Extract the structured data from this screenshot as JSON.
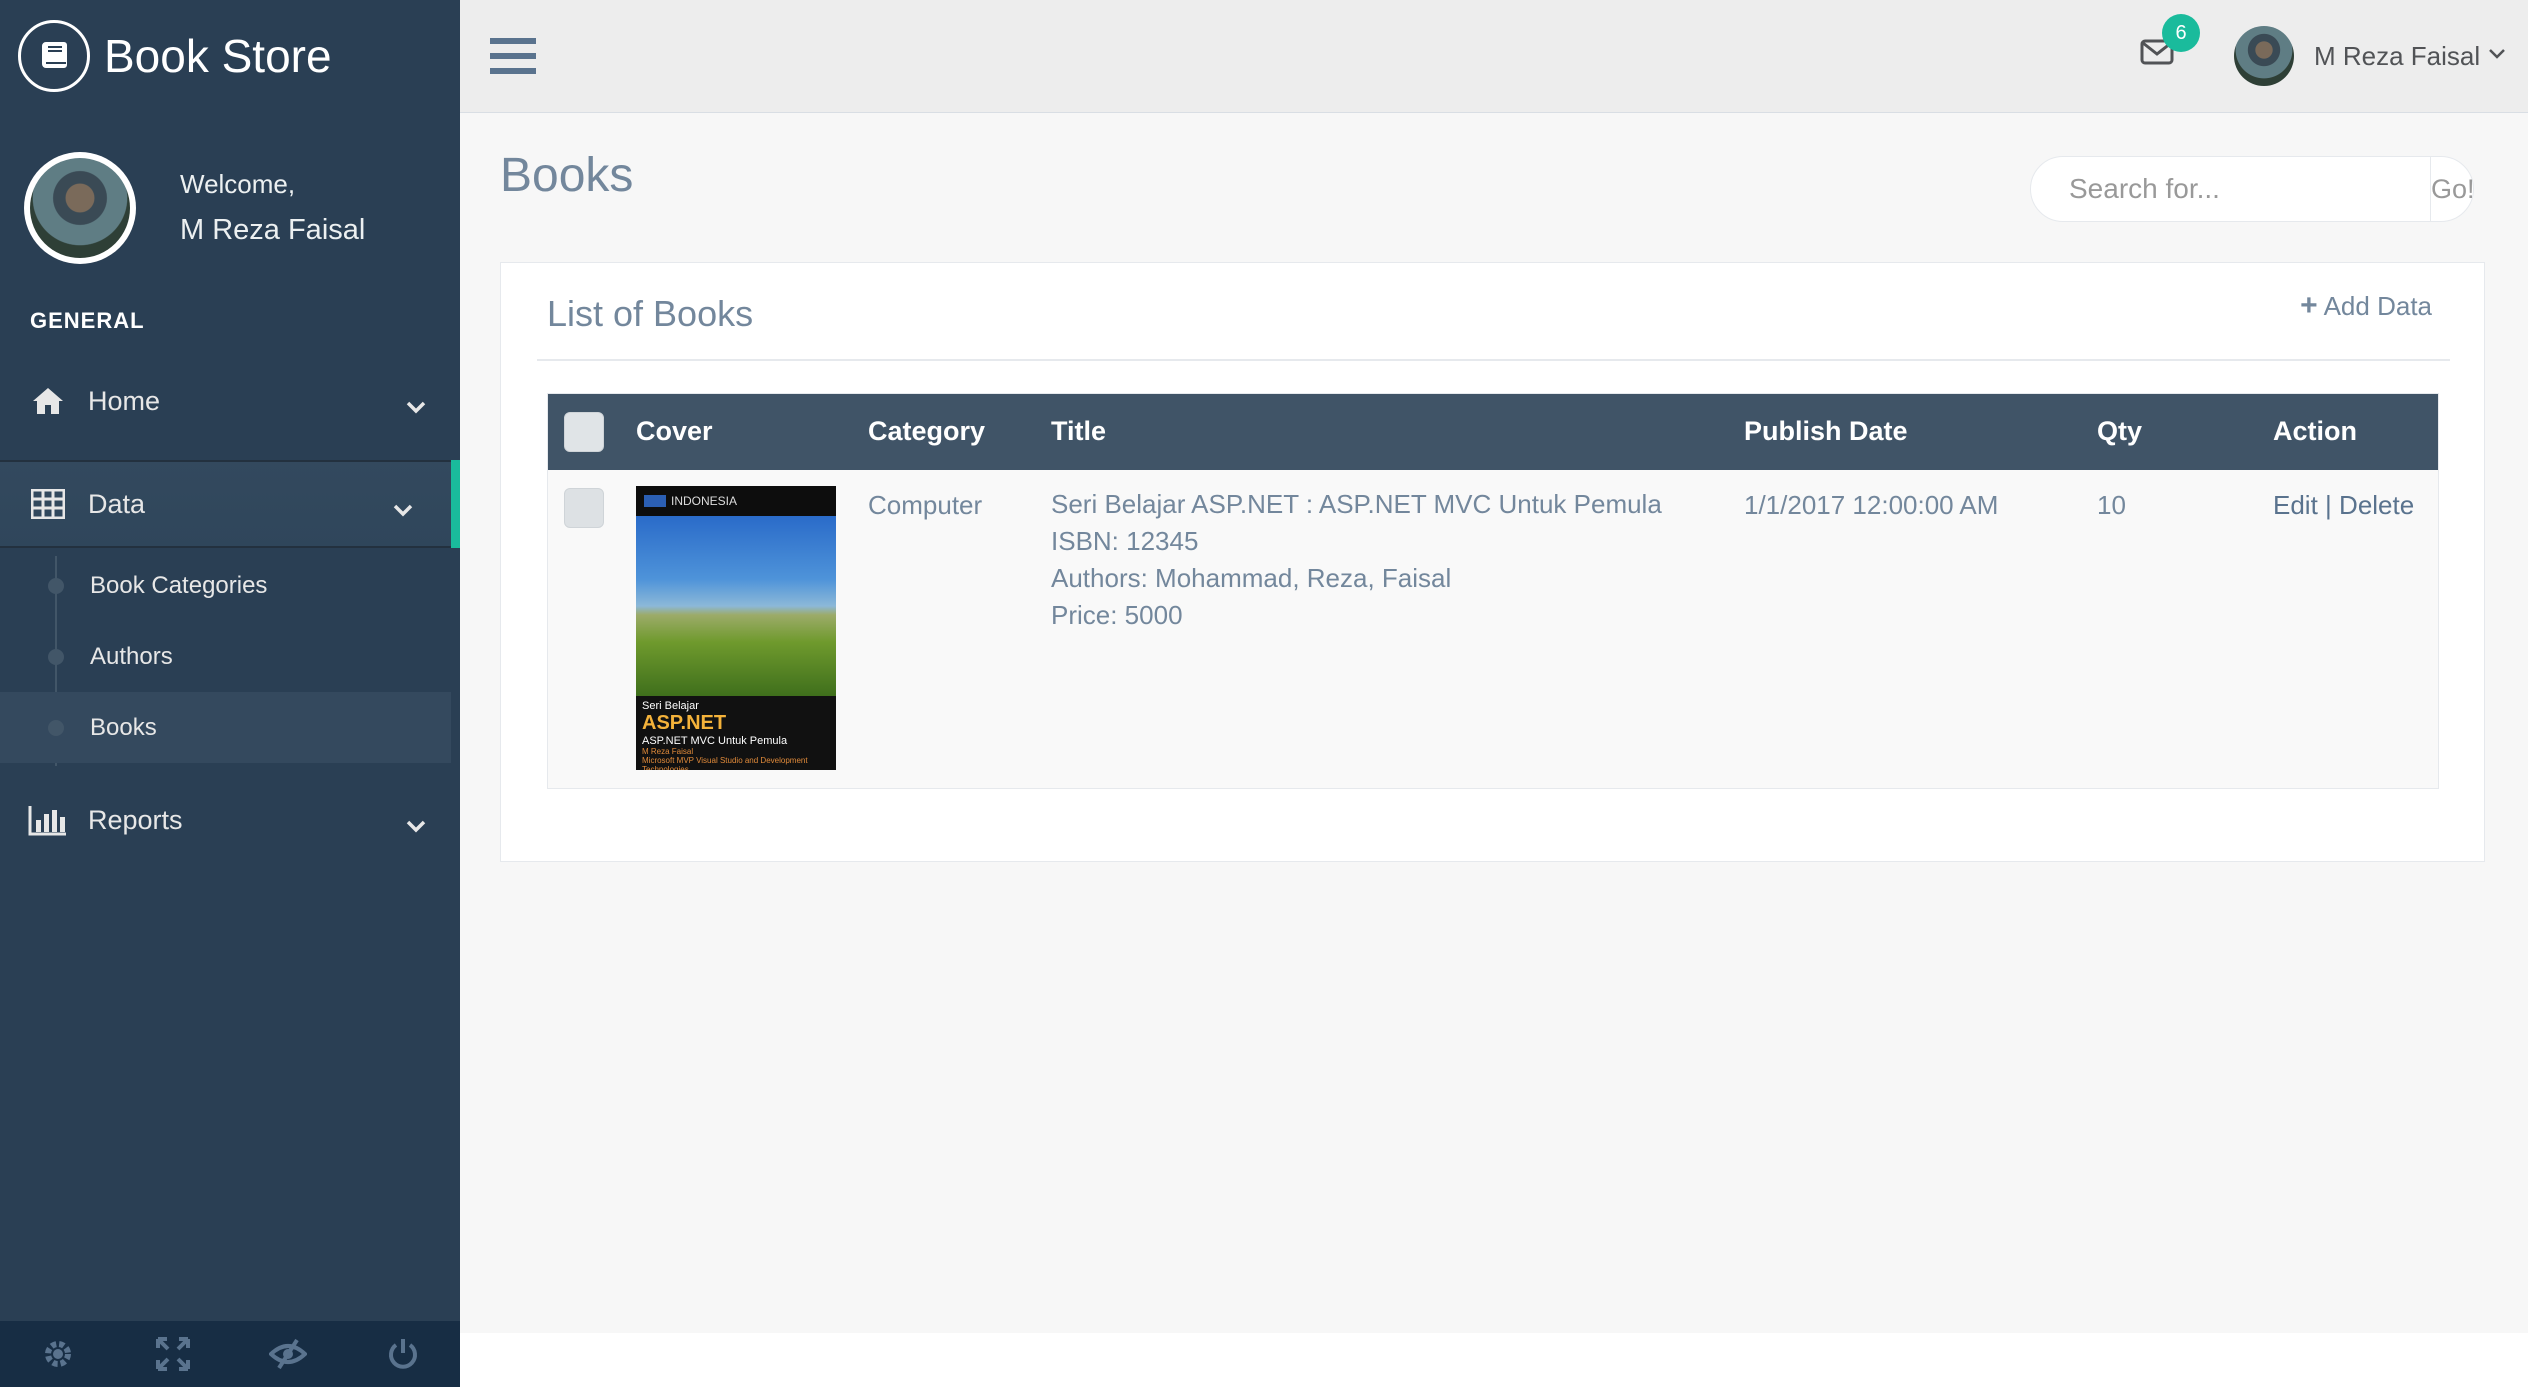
{
  "sidebar": {
    "brand": "Book Store",
    "welcome": "Welcome,",
    "user_name": "M Reza Faisal",
    "section": "GENERAL",
    "menu": {
      "home": "Home",
      "data": "Data",
      "reports": "Reports"
    },
    "submenu": [
      "Book Categories",
      "Authors",
      "Books"
    ]
  },
  "topnav": {
    "mail_count": "6",
    "user_name": "M Reza Faisal"
  },
  "page": {
    "title": "Books",
    "search_placeholder": "Search for...",
    "search_button": "Go!"
  },
  "panel": {
    "title": "List of Books",
    "add_label": "Add Data"
  },
  "table": {
    "headers": [
      "Cover",
      "Category",
      "Title",
      "Publish Date",
      "Qty",
      "Action"
    ],
    "rows": [
      {
        "cover": {
          "publisher": "INDONESIA",
          "series": "Seri Belajar",
          "big_title": "ASP.NET",
          "subtitle": "ASP.NET MVC Untuk Pemula",
          "author": "M Reza Faisal",
          "tagline": "Microsoft MVP Visual Studio and Development Technologies"
        },
        "category": "Computer",
        "title": "Seri Belajar ASP.NET : ASP.NET MVC Untuk Pemula",
        "isbn": "ISBN: 12345",
        "authors": "Authors: Mohammad, Reza, Faisal",
        "price": "Price: 5000",
        "publish_date": "1/1/2017 12:00:00 AM",
        "qty": "10",
        "edit": "Edit",
        "separator": "|",
        "delete": "Delete"
      }
    ]
  },
  "colors": {
    "sidebar": "#2A3F54",
    "accent": "#1ABB9C",
    "table_header": "#405467"
  }
}
